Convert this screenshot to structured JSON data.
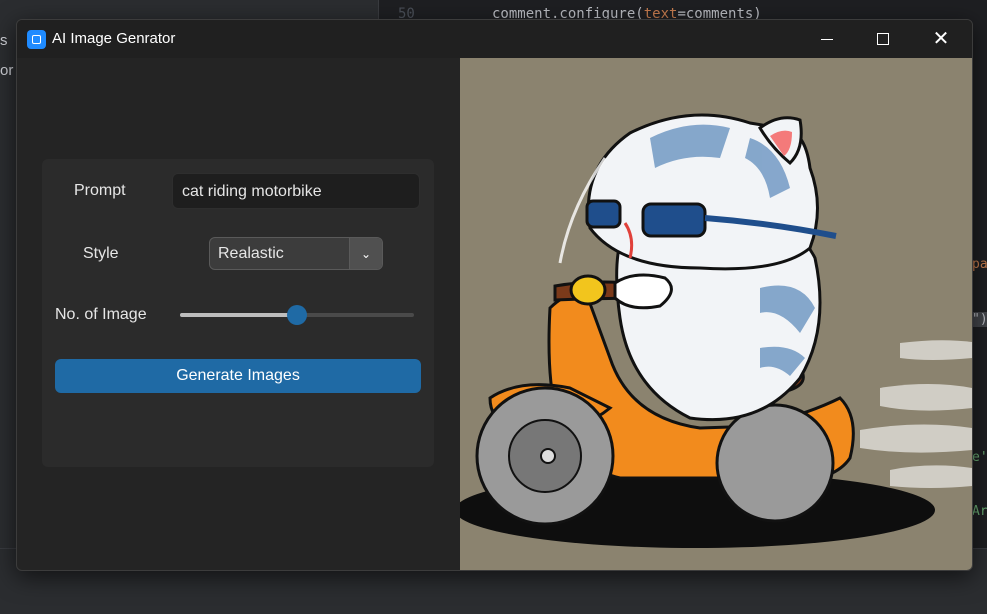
{
  "background_ide": {
    "line_number": "50",
    "code_prefix": "comment.configure(",
    "code_keyword": "text",
    "code_suffix": "=comments)",
    "side_fragments": [
      "s",
      "or"
    ],
    "right_fragments": [
      "pa",
      "\")",
      "e'",
      "Ar"
    ]
  },
  "window": {
    "title": "AI Image Genrator",
    "icon": "app-icon"
  },
  "controls": {
    "prompt_label": "Prompt",
    "prompt_value": "cat riding motorbike",
    "style_label": "Style",
    "style_value": "Realastic",
    "num_images_label": "No. of Image",
    "num_images_value": 0.5,
    "generate_label": "Generate Images"
  },
  "image": {
    "description_icon": "generated-image"
  },
  "colors": {
    "accent": "#1f6aa5",
    "window_bg": "#242424",
    "panel_bg": "#2b2b2b"
  }
}
